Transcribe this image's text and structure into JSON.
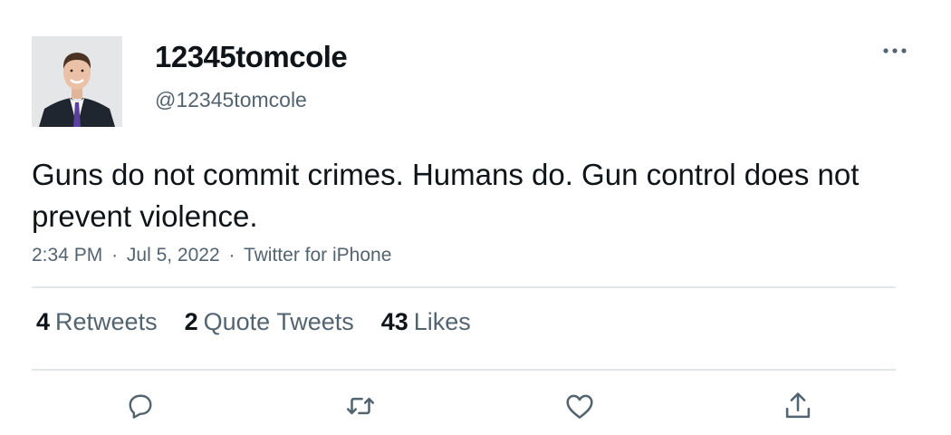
{
  "user": {
    "display_name": "12345tomcole",
    "handle": "@12345tomcole",
    "avatar_icon": "profile-photo"
  },
  "tweet": {
    "text": "Guns do not commit crimes. Humans do. Gun control does not prevent violence."
  },
  "meta": {
    "time": "2:34 PM",
    "separator": "·",
    "date": "Jul 5, 2022",
    "source": "Twitter for iPhone"
  },
  "stats": [
    {
      "count": "4",
      "label": "Retweets"
    },
    {
      "count": "2",
      "label": "Quote Tweets"
    },
    {
      "count": "43",
      "label": "Likes"
    }
  ],
  "actions": {
    "more_icon": "ellipsis-icon",
    "reply_icon": "reply-icon",
    "retweet_icon": "retweet-icon",
    "like_icon": "heart-icon",
    "share_icon": "share-icon"
  },
  "colors": {
    "text_primary": "#0f1419",
    "text_secondary": "#536471",
    "divider": "#e1e6ea",
    "tie_accent": "#5b3fa0"
  }
}
